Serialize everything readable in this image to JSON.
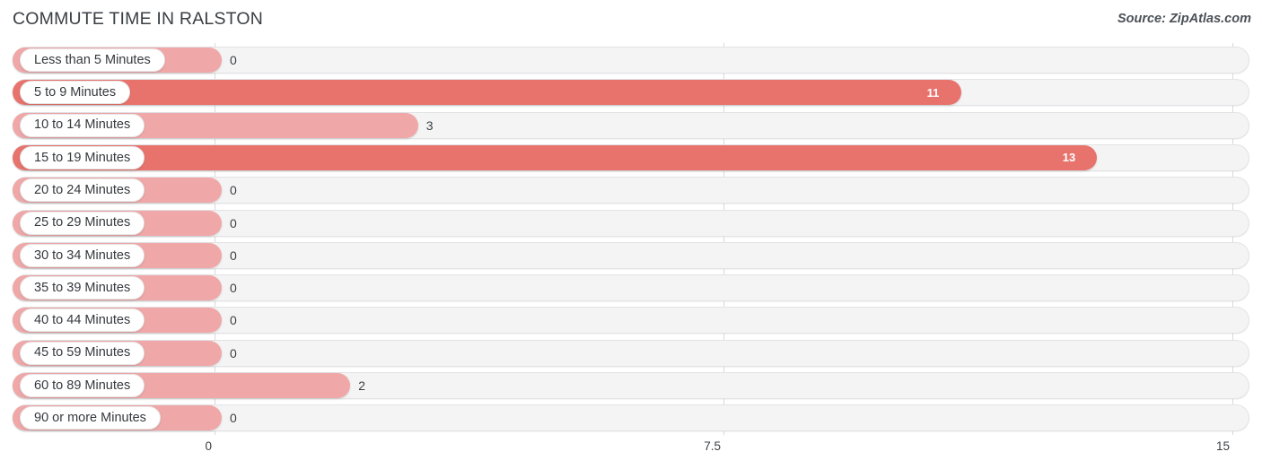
{
  "header": {
    "title": "COMMUTE TIME IN RALSTON",
    "source": "Source: ZipAtlas.com"
  },
  "colors": {
    "bar_strong": "#e8736d",
    "bar_light": "#f0a7a7",
    "track": "#f4f4f5",
    "gridline": "#d9d9d9",
    "text": "#3c4043"
  },
  "axis": {
    "ticks": [
      "0",
      "7.5",
      "15"
    ],
    "min": 0,
    "max": 15
  },
  "chart_data": {
    "type": "bar",
    "orientation": "horizontal",
    "title": "COMMUTE TIME IN RALSTON",
    "subtitle": "Source: ZipAtlas.com",
    "xlabel": "",
    "ylabel": "",
    "xlim": [
      0,
      15
    ],
    "xticks": [
      0,
      7.5,
      15
    ],
    "grid": true,
    "legend": "none",
    "categories": [
      "Less than 5 Minutes",
      "5 to 9 Minutes",
      "10 to 14 Minutes",
      "15 to 19 Minutes",
      "20 to 24 Minutes",
      "25 to 29 Minutes",
      "30 to 34 Minutes",
      "35 to 39 Minutes",
      "40 to 44 Minutes",
      "45 to 59 Minutes",
      "60 to 89 Minutes",
      "90 or more Minutes"
    ],
    "values": [
      0,
      11,
      3,
      13,
      0,
      0,
      0,
      0,
      0,
      0,
      2,
      0
    ],
    "value_labels": [
      "0",
      "11",
      "3",
      "13",
      "0",
      "0",
      "0",
      "0",
      "0",
      "0",
      "2",
      "0"
    ]
  },
  "rows": [
    {
      "label": "Less than 5 Minutes",
      "value": 0,
      "value_label": "0",
      "emphasis": "light"
    },
    {
      "label": "5 to 9 Minutes",
      "value": 11,
      "value_label": "11",
      "emphasis": "strong"
    },
    {
      "label": "10 to 14 Minutes",
      "value": 3,
      "value_label": "3",
      "emphasis": "light"
    },
    {
      "label": "15 to 19 Minutes",
      "value": 13,
      "value_label": "13",
      "emphasis": "strong"
    },
    {
      "label": "20 to 24 Minutes",
      "value": 0,
      "value_label": "0",
      "emphasis": "light"
    },
    {
      "label": "25 to 29 Minutes",
      "value": 0,
      "value_label": "0",
      "emphasis": "light"
    },
    {
      "label": "30 to 34 Minutes",
      "value": 0,
      "value_label": "0",
      "emphasis": "light"
    },
    {
      "label": "35 to 39 Minutes",
      "value": 0,
      "value_label": "0",
      "emphasis": "light"
    },
    {
      "label": "40 to 44 Minutes",
      "value": 0,
      "value_label": "0",
      "emphasis": "light"
    },
    {
      "label": "45 to 59 Minutes",
      "value": 0,
      "value_label": "0",
      "emphasis": "light"
    },
    {
      "label": "60 to 89 Minutes",
      "value": 2,
      "value_label": "2",
      "emphasis": "light"
    },
    {
      "label": "90 or more Minutes",
      "value": 0,
      "value_label": "0",
      "emphasis": "light"
    }
  ]
}
